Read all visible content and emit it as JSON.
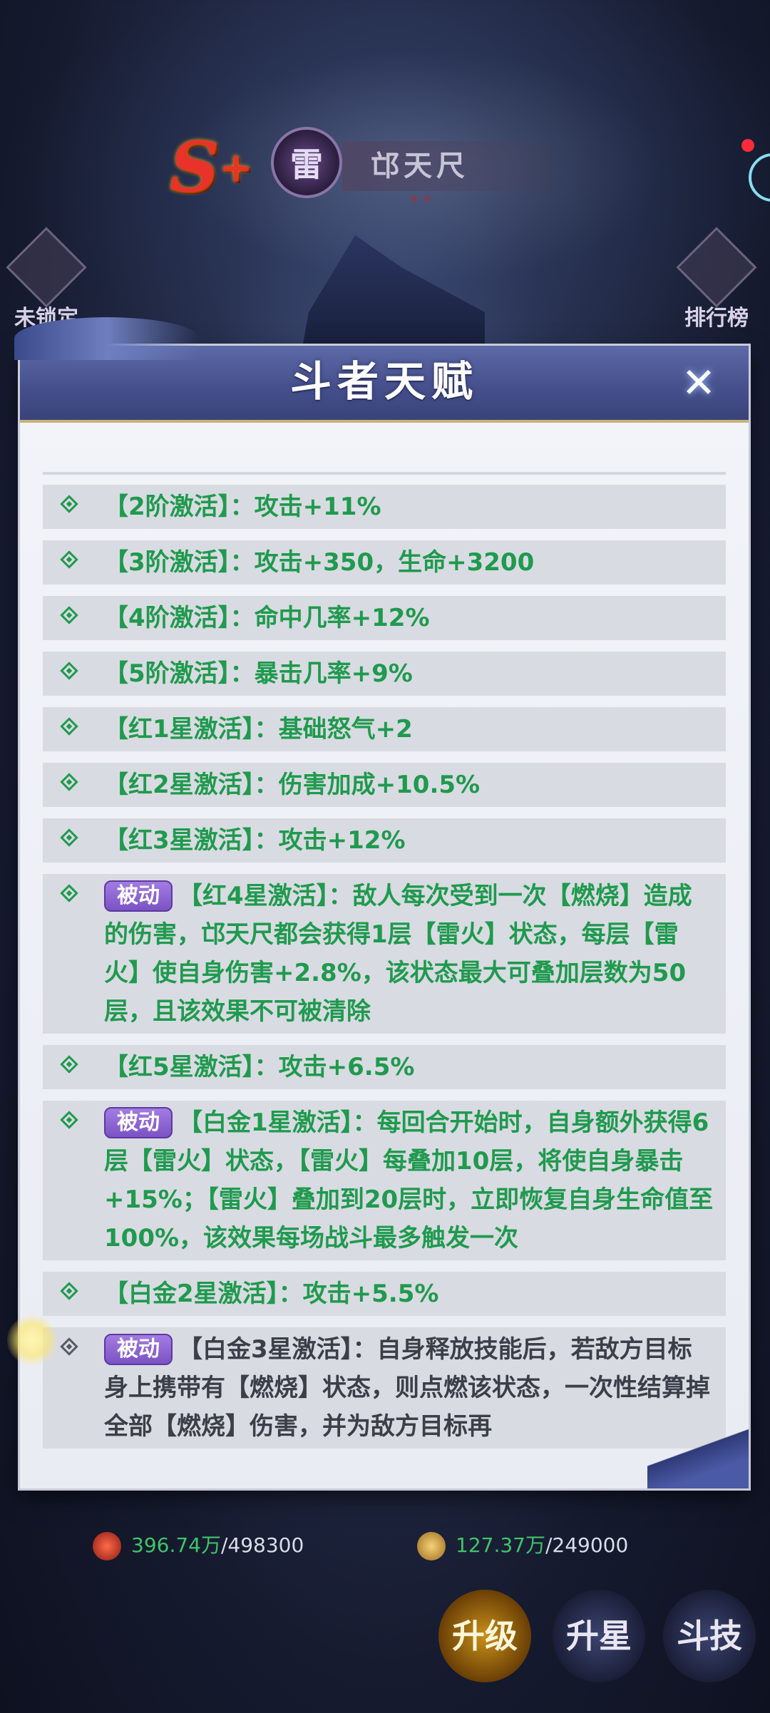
{
  "hero": {
    "grade": "S",
    "grade_plus": "+",
    "element": "雷",
    "name": "邙天尺",
    "sub": "✦✦"
  },
  "corner": {
    "left_label": "未锁定",
    "right_label": "排行榜"
  },
  "modal": {
    "title": "斗者天赋",
    "close_label": "✕",
    "passive_label": "被动",
    "rows": [
      {
        "text": "【2阶激活】：攻击+11%"
      },
      {
        "text": "【3阶激活】：攻击+350，生命+3200"
      },
      {
        "text": "【4阶激活】：命中几率+12%"
      },
      {
        "text": "【5阶激活】：暴击几率+9%"
      },
      {
        "text": "【红1星激活】：基础怒气+2"
      },
      {
        "text": "【红2星激活】：伤害加成+10.5%"
      },
      {
        "text": "【红3星激活】：攻击+12%"
      },
      {
        "text": "【红4星激活】：敌人每次受到一次【燃烧】造成的伤害，邙天尺都会获得1层【雷火】状态，每层【雷火】使自身伤害+2.8%，该状态最大可叠加层数为50层，且该效果不可被清除"
      },
      {
        "text": "【红5星激活】：攻击+6.5%"
      },
      {
        "text": "【白金1星激活】：每回合开始时，自身额外获得6层【雷火】状态，【雷火】每叠加10层，将使自身暴击+15%；【雷火】叠加到20层时，立即恢复自身生命值至100%，该效果每场战斗最多触发一次"
      },
      {
        "text": "【白金2星激活】：攻击+5.5%"
      },
      {
        "text": "【白金3星激活】：自身释放技能后，若敌方目标身上携带有【燃烧】状态，则点燃该状态，一次性结算掉全部【燃烧】伤害，并为敌方目标再"
      }
    ]
  },
  "resources": {
    "res1_amount": "396.74万",
    "res1_total": "/498300",
    "res2_amount": "127.37万",
    "res2_total": "/249000"
  },
  "actions": {
    "upgrade": "升级",
    "upstar": "升星",
    "skill": "斗技"
  },
  "colors": {
    "accent_green": "#1f9a4e",
    "header_blue": "#46508d",
    "passive_purple": "#7b53c4"
  }
}
